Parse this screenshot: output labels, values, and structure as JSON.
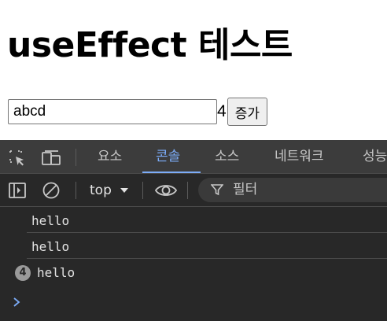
{
  "page": {
    "title": "useEffect 테스트",
    "input_value": "abcd",
    "count": "4",
    "increment_label": "증가"
  },
  "devtools": {
    "tabs": [
      "요소",
      "콘솔",
      "소스",
      "네트워크",
      "성능"
    ],
    "active_tab": "콘솔",
    "context_label": "top",
    "filter_placeholder": "필터",
    "accent_color": "#7cacf8",
    "icons": [
      "inspect-element-icon",
      "device-toolbar-icon",
      "sidebar-toggle-icon",
      "clear-console-icon",
      "eye-icon",
      "filter-icon",
      "chevron-down-icon",
      "chevron-right-icon"
    ],
    "logs": [
      {
        "text": "hello",
        "repeat": ""
      },
      {
        "text": "hello",
        "repeat": ""
      },
      {
        "text": "hello",
        "repeat": "4"
      }
    ]
  }
}
